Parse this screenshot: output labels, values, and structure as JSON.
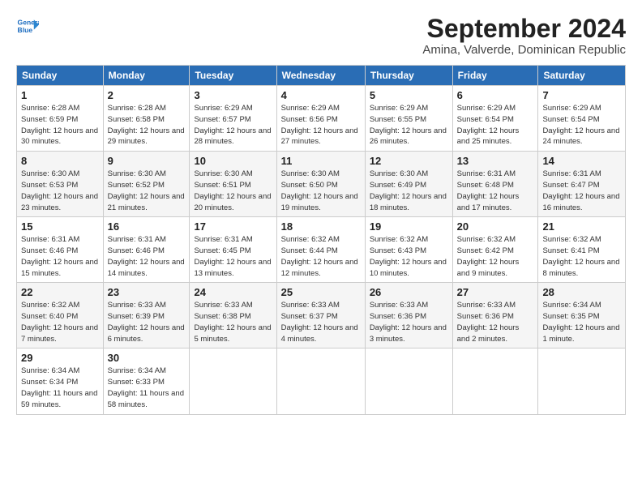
{
  "header": {
    "logo_line1": "General",
    "logo_line2": "Blue",
    "title": "September 2024",
    "subtitle": "Amina, Valverde, Dominican Republic"
  },
  "columns": [
    "Sunday",
    "Monday",
    "Tuesday",
    "Wednesday",
    "Thursday",
    "Friday",
    "Saturday"
  ],
  "weeks": [
    [
      {
        "day": "1",
        "sunrise": "Sunrise: 6:28 AM",
        "sunset": "Sunset: 6:59 PM",
        "daylight": "Daylight: 12 hours and 30 minutes."
      },
      {
        "day": "2",
        "sunrise": "Sunrise: 6:28 AM",
        "sunset": "Sunset: 6:58 PM",
        "daylight": "Daylight: 12 hours and 29 minutes."
      },
      {
        "day": "3",
        "sunrise": "Sunrise: 6:29 AM",
        "sunset": "Sunset: 6:57 PM",
        "daylight": "Daylight: 12 hours and 28 minutes."
      },
      {
        "day": "4",
        "sunrise": "Sunrise: 6:29 AM",
        "sunset": "Sunset: 6:56 PM",
        "daylight": "Daylight: 12 hours and 27 minutes."
      },
      {
        "day": "5",
        "sunrise": "Sunrise: 6:29 AM",
        "sunset": "Sunset: 6:55 PM",
        "daylight": "Daylight: 12 hours and 26 minutes."
      },
      {
        "day": "6",
        "sunrise": "Sunrise: 6:29 AM",
        "sunset": "Sunset: 6:54 PM",
        "daylight": "Daylight: 12 hours and 25 minutes."
      },
      {
        "day": "7",
        "sunrise": "Sunrise: 6:29 AM",
        "sunset": "Sunset: 6:54 PM",
        "daylight": "Daylight: 12 hours and 24 minutes."
      }
    ],
    [
      {
        "day": "8",
        "sunrise": "Sunrise: 6:30 AM",
        "sunset": "Sunset: 6:53 PM",
        "daylight": "Daylight: 12 hours and 23 minutes."
      },
      {
        "day": "9",
        "sunrise": "Sunrise: 6:30 AM",
        "sunset": "Sunset: 6:52 PM",
        "daylight": "Daylight: 12 hours and 21 minutes."
      },
      {
        "day": "10",
        "sunrise": "Sunrise: 6:30 AM",
        "sunset": "Sunset: 6:51 PM",
        "daylight": "Daylight: 12 hours and 20 minutes."
      },
      {
        "day": "11",
        "sunrise": "Sunrise: 6:30 AM",
        "sunset": "Sunset: 6:50 PM",
        "daylight": "Daylight: 12 hours and 19 minutes."
      },
      {
        "day": "12",
        "sunrise": "Sunrise: 6:30 AM",
        "sunset": "Sunset: 6:49 PM",
        "daylight": "Daylight: 12 hours and 18 minutes."
      },
      {
        "day": "13",
        "sunrise": "Sunrise: 6:31 AM",
        "sunset": "Sunset: 6:48 PM",
        "daylight": "Daylight: 12 hours and 17 minutes."
      },
      {
        "day": "14",
        "sunrise": "Sunrise: 6:31 AM",
        "sunset": "Sunset: 6:47 PM",
        "daylight": "Daylight: 12 hours and 16 minutes."
      }
    ],
    [
      {
        "day": "15",
        "sunrise": "Sunrise: 6:31 AM",
        "sunset": "Sunset: 6:46 PM",
        "daylight": "Daylight: 12 hours and 15 minutes."
      },
      {
        "day": "16",
        "sunrise": "Sunrise: 6:31 AM",
        "sunset": "Sunset: 6:46 PM",
        "daylight": "Daylight: 12 hours and 14 minutes."
      },
      {
        "day": "17",
        "sunrise": "Sunrise: 6:31 AM",
        "sunset": "Sunset: 6:45 PM",
        "daylight": "Daylight: 12 hours and 13 minutes."
      },
      {
        "day": "18",
        "sunrise": "Sunrise: 6:32 AM",
        "sunset": "Sunset: 6:44 PM",
        "daylight": "Daylight: 12 hours and 12 minutes."
      },
      {
        "day": "19",
        "sunrise": "Sunrise: 6:32 AM",
        "sunset": "Sunset: 6:43 PM",
        "daylight": "Daylight: 12 hours and 10 minutes."
      },
      {
        "day": "20",
        "sunrise": "Sunrise: 6:32 AM",
        "sunset": "Sunset: 6:42 PM",
        "daylight": "Daylight: 12 hours and 9 minutes."
      },
      {
        "day": "21",
        "sunrise": "Sunrise: 6:32 AM",
        "sunset": "Sunset: 6:41 PM",
        "daylight": "Daylight: 12 hours and 8 minutes."
      }
    ],
    [
      {
        "day": "22",
        "sunrise": "Sunrise: 6:32 AM",
        "sunset": "Sunset: 6:40 PM",
        "daylight": "Daylight: 12 hours and 7 minutes."
      },
      {
        "day": "23",
        "sunrise": "Sunrise: 6:33 AM",
        "sunset": "Sunset: 6:39 PM",
        "daylight": "Daylight: 12 hours and 6 minutes."
      },
      {
        "day": "24",
        "sunrise": "Sunrise: 6:33 AM",
        "sunset": "Sunset: 6:38 PM",
        "daylight": "Daylight: 12 hours and 5 minutes."
      },
      {
        "day": "25",
        "sunrise": "Sunrise: 6:33 AM",
        "sunset": "Sunset: 6:37 PM",
        "daylight": "Daylight: 12 hours and 4 minutes."
      },
      {
        "day": "26",
        "sunrise": "Sunrise: 6:33 AM",
        "sunset": "Sunset: 6:36 PM",
        "daylight": "Daylight: 12 hours and 3 minutes."
      },
      {
        "day": "27",
        "sunrise": "Sunrise: 6:33 AM",
        "sunset": "Sunset: 6:36 PM",
        "daylight": "Daylight: 12 hours and 2 minutes."
      },
      {
        "day": "28",
        "sunrise": "Sunrise: 6:34 AM",
        "sunset": "Sunset: 6:35 PM",
        "daylight": "Daylight: 12 hours and 1 minute."
      }
    ],
    [
      {
        "day": "29",
        "sunrise": "Sunrise: 6:34 AM",
        "sunset": "Sunset: 6:34 PM",
        "daylight": "Daylight: 11 hours and 59 minutes."
      },
      {
        "day": "30",
        "sunrise": "Sunrise: 6:34 AM",
        "sunset": "Sunset: 6:33 PM",
        "daylight": "Daylight: 11 hours and 58 minutes."
      },
      null,
      null,
      null,
      null,
      null
    ]
  ]
}
